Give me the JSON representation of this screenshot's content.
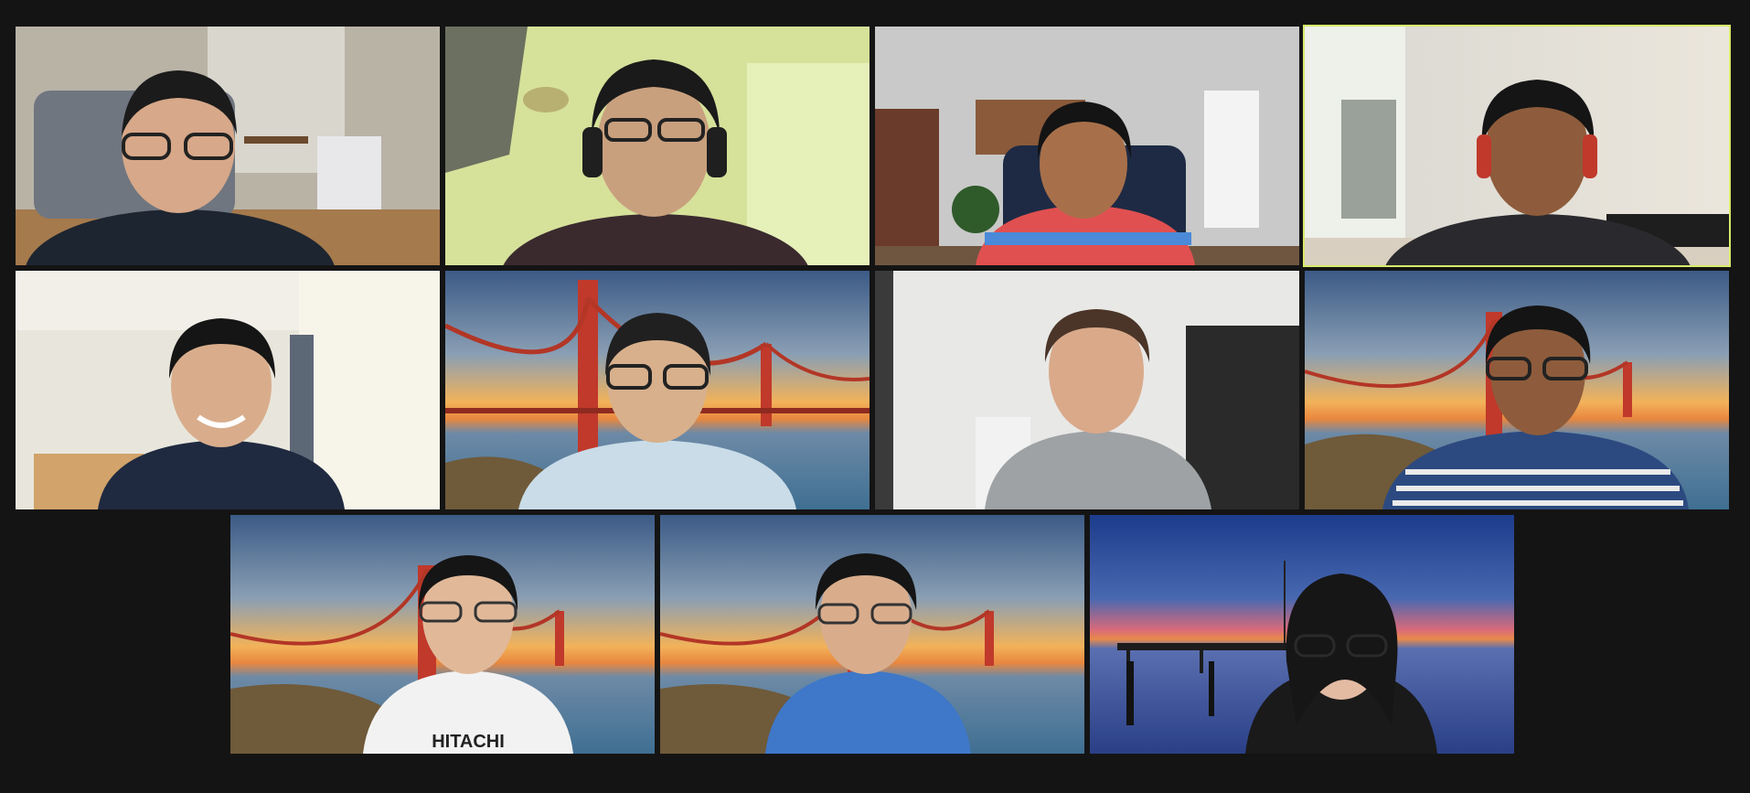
{
  "meeting": {
    "view": "gallery",
    "active_speaker_index": 3,
    "accent_color": "#d7ea6a",
    "background_color": "#141414"
  },
  "participants": [
    {
      "background": "living-room",
      "shirt": "#1d2530",
      "glasses": true,
      "headphones": false
    },
    {
      "background": "ceiling-room",
      "shirt": "#3a2a2e",
      "glasses": true,
      "headphones": true
    },
    {
      "background": "kitchen-apartment",
      "shirt": "#e05050",
      "glasses": false,
      "headphones": false
    },
    {
      "background": "bright-room",
      "shirt": "#2a2a2e",
      "glasses": false,
      "headphones": true
    },
    {
      "background": "white-room",
      "shirt": "#1f2a40",
      "glasses": false,
      "headphones": false
    },
    {
      "background": "golden-gate",
      "shirt": "#c9dce8",
      "glasses": true,
      "headphones": false
    },
    {
      "background": "gym-room",
      "shirt": "#9ea2a5",
      "glasses": false,
      "headphones": false
    },
    {
      "background": "golden-gate",
      "shirt": "#2c4a80",
      "glasses": true,
      "headphones": false
    },
    {
      "background": "golden-gate",
      "shirt": "#f2f2f2",
      "shirt_text": "HITACHI",
      "glasses": true,
      "headphones": false
    },
    {
      "background": "golden-gate",
      "shirt": "#3f78c8",
      "glasses": true,
      "headphones": false
    },
    {
      "background": "sunset-pier",
      "shirt": "#1a1a1a",
      "glasses": true,
      "headphones": false
    }
  ]
}
